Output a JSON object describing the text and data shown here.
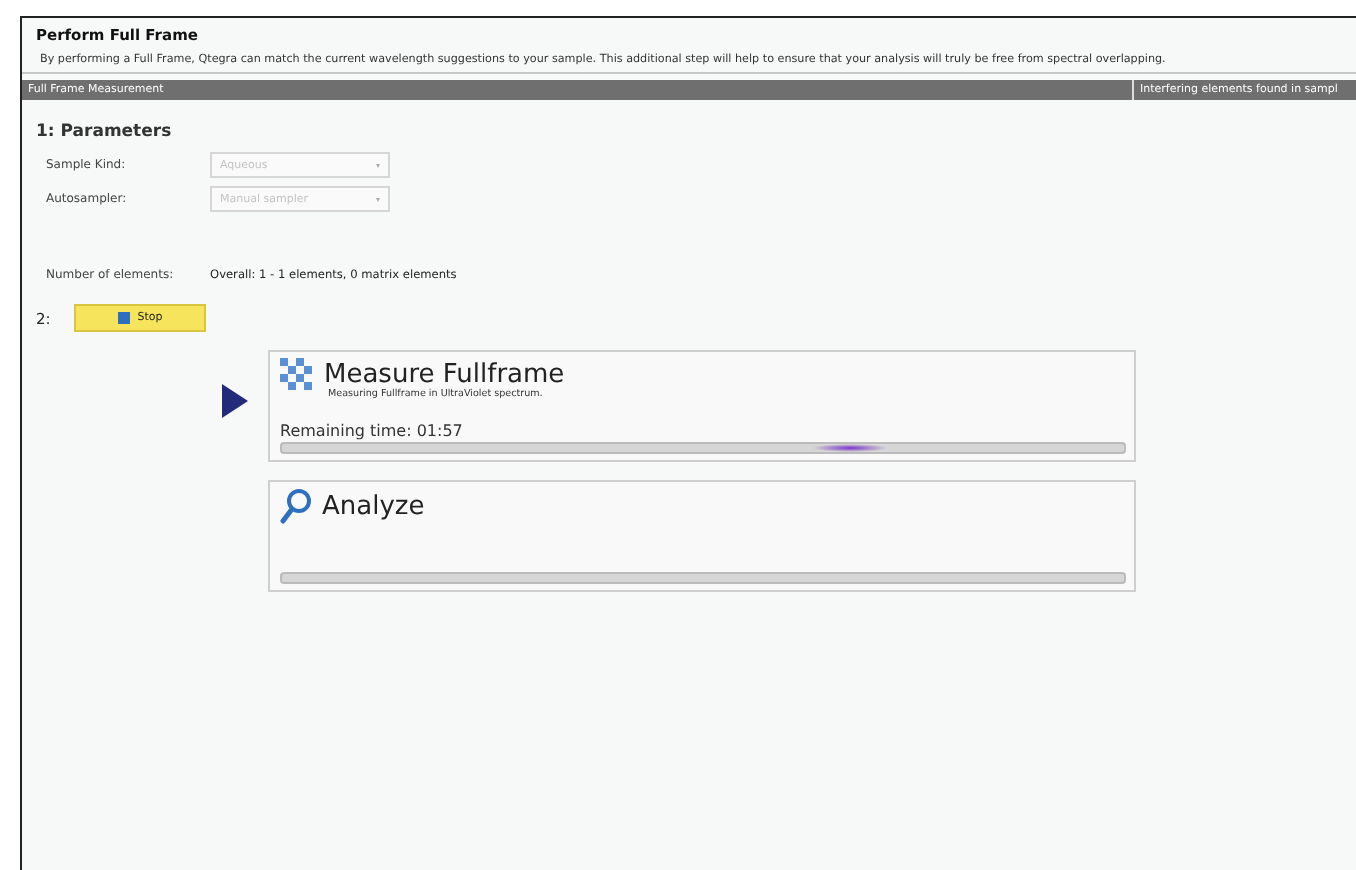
{
  "header": {
    "title": "Perform Full Frame",
    "description": "By performing a Full Frame, Qtegra can match the current wavelength suggestions to your sample. This additional step will help to ensure that your analysis will truly be free from spectral overlapping."
  },
  "columns": [
    "Full Frame Measurement",
    "Interfering elements found in sampl"
  ],
  "parameters": {
    "heading": "1: Parameters",
    "fields": [
      {
        "label": "Sample Kind:",
        "value": "Aqueous",
        "disabled": true
      },
      {
        "label": "Autosampler:",
        "value": "Manual sampler",
        "disabled": true
      }
    ],
    "count_label": "Number of elements:",
    "count_value": "Overall: 1 - 1 elements, 0 matrix elements"
  },
  "step_number": "2:",
  "stop_button": "Stop",
  "steps": [
    {
      "kind": "measure",
      "title": "Measure Fullframe",
      "subtitle": "Measuring Fullframe in UltraViolet spectrum.",
      "remaining": "Remaining time: 01:57",
      "active": true
    },
    {
      "kind": "analyze",
      "title": "Analyze",
      "active": false
    }
  ]
}
